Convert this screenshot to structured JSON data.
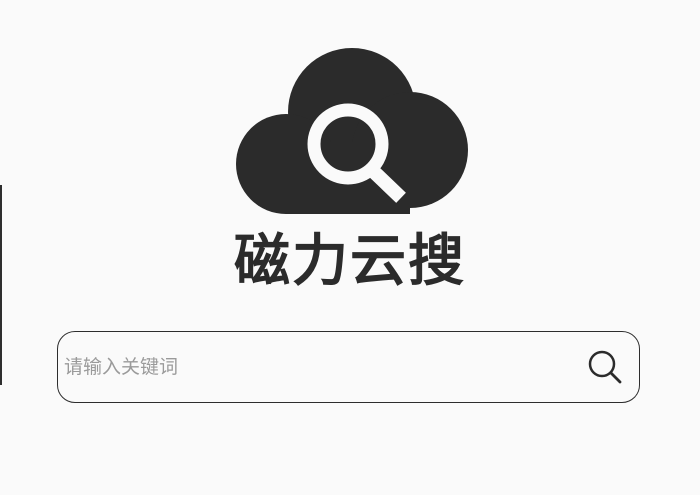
{
  "brand": {
    "title": "磁力云搜",
    "logo_icon": "cloud-search-icon",
    "color": "#2b2b2b"
  },
  "search": {
    "placeholder": "请输入关键词",
    "value": "",
    "button_icon": "search-icon"
  },
  "colors": {
    "background": "#fafafa",
    "foreground": "#2b2b2b",
    "placeholder": "#9a9a9a"
  }
}
